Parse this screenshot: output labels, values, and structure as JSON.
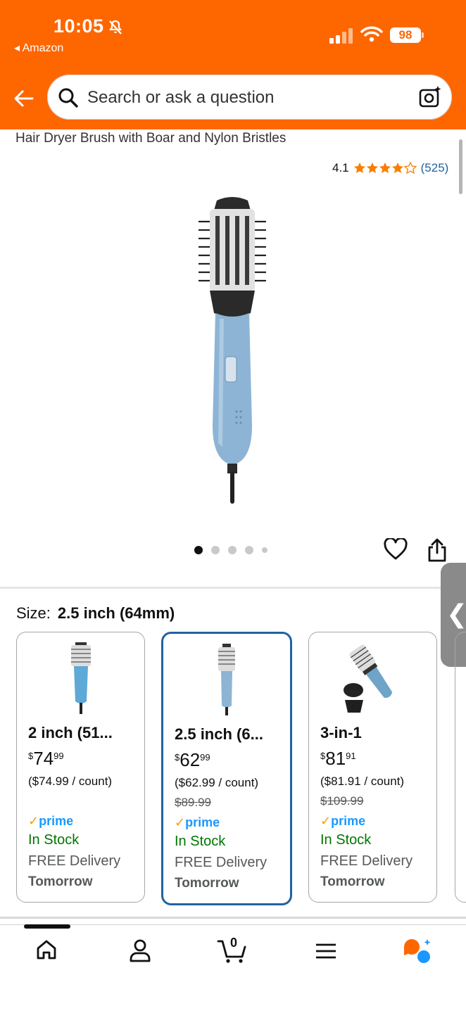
{
  "status_bar": {
    "time": "10:05",
    "back_app": "◂ Amazon",
    "battery": "98"
  },
  "search": {
    "placeholder": "Search or ask a question"
  },
  "product": {
    "title": "Hair Dryer Brush with Boar and Nylon Bristles",
    "rating_value": "4.1",
    "rating_stars": 4.1,
    "rating_count": "(525)",
    "image_count": 5,
    "current_image": 1
  },
  "size": {
    "label": "Size:",
    "selected": "2.5 inch (64mm)"
  },
  "options": [
    {
      "name": "2 inch (51...",
      "price_whole": "74",
      "price_cents": "99",
      "price_symbol": "$",
      "unit_price": "($74.99 / count)",
      "list_price": "",
      "prime": "prime",
      "stock": "In Stock",
      "delivery": "FREE Delivery",
      "delivery_day": "Tomorrow"
    },
    {
      "name": "2.5 inch (6...",
      "price_whole": "62",
      "price_cents": "99",
      "price_symbol": "$",
      "unit_price": "($62.99 / count)",
      "list_price": "$89.99",
      "prime": "prime",
      "stock": "In Stock",
      "delivery": "FREE Delivery",
      "delivery_day": "Tomorrow"
    },
    {
      "name": "3-in-1",
      "price_whole": "81",
      "price_cents": "91",
      "price_symbol": "$",
      "unit_price": "($81.91 / count)",
      "list_price": "$109.99",
      "prime": "prime",
      "stock": "In Stock",
      "delivery": "FREE Delivery",
      "delivery_day": "Tomorrow"
    }
  ],
  "bottom_nav": {
    "cart_count": "0",
    "items": [
      "home-icon",
      "account-icon",
      "cart-icon",
      "menu-icon",
      "rufus-icon"
    ]
  },
  "colors": {
    "header": "#fe6600",
    "selected_border": "#2162a1",
    "star": "#f77f00",
    "in_stock": "#007600",
    "prime": "#1a98ff"
  }
}
